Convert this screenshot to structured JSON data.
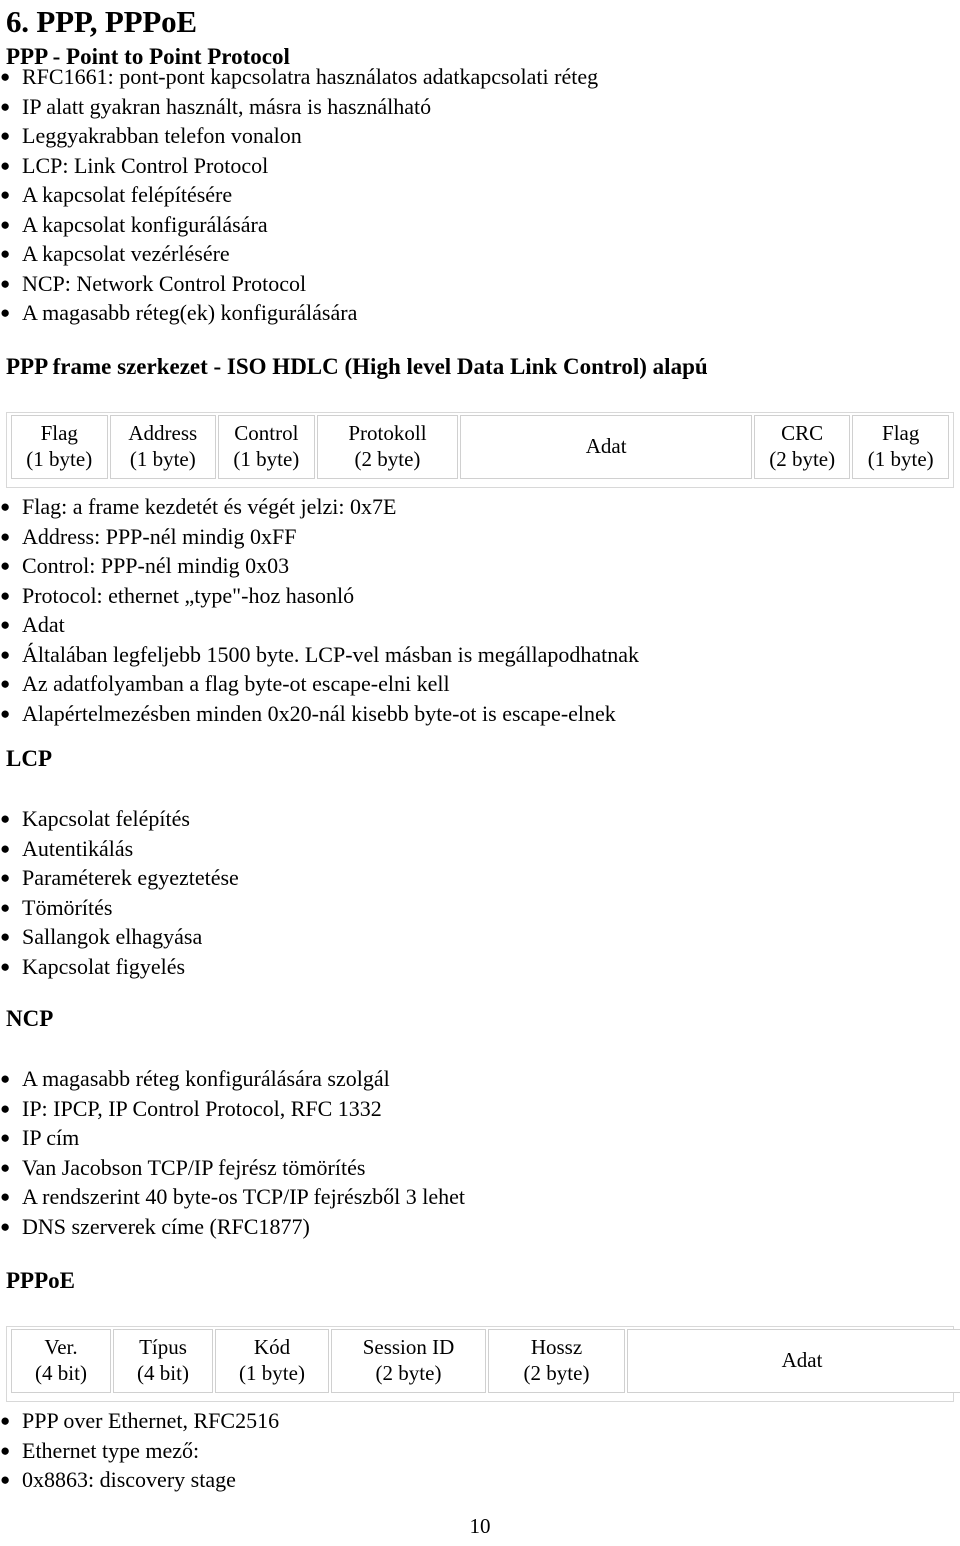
{
  "document": {
    "slide_number_label": "10",
    "title": "6. PPP, PPPoE",
    "subtitle": "PPP - Point to Point Protocol"
  },
  "intro_bullets": [
    {
      "level": 1,
      "text": "RFC1661: pont-pont kapcsolatra használatos adatkapcsolati réteg"
    },
    {
      "level": 1,
      "text": "IP alatt gyakran használt, másra is használható"
    },
    {
      "level": 1,
      "text": "Leggyakrabban telefon vonalon"
    },
    {
      "level": 1,
      "text": "LCP: Link Control Protocol"
    },
    {
      "level": 2,
      "text": "A kapcsolat felépítésére"
    },
    {
      "level": 2,
      "text": "A kapcsolat konfigurálására"
    },
    {
      "level": 2,
      "text": "A kapcsolat vezérlésére"
    },
    {
      "level": 1,
      "text": "NCP: Network Control Protocol"
    },
    {
      "level": 2,
      "text": "A magasabb réteg(ek) konfigurálására"
    }
  ],
  "ppp_frame": {
    "heading": "PPP frame szerkezet - ISO HDLC (High level Data Link Control) alapú",
    "fields": [
      {
        "name": "Flag",
        "size": "(1 byte)"
      },
      {
        "name": "Address",
        "size": "(1 byte)"
      },
      {
        "name": "Control",
        "size": "(1 byte)"
      },
      {
        "name": "Protokoll",
        "size": "(2 byte)"
      },
      {
        "name": "Adat",
        "size": ""
      },
      {
        "name": "CRC",
        "size": "(2 byte)"
      },
      {
        "name": "Flag",
        "size": "(1 byte)"
      }
    ],
    "bullets": [
      {
        "level": 1,
        "text": "Flag: a frame kezdetét és végét jelzi: 0x7E"
      },
      {
        "level": 1,
        "text": "Address: PPP-nél mindig 0xFF"
      },
      {
        "level": 1,
        "text": "Control: PPP-nél mindig 0x03"
      },
      {
        "level": 1,
        "text": "Protocol: ethernet „type\"-hoz hasonló"
      },
      {
        "level": 1,
        "text": "Adat"
      },
      {
        "level": 2,
        "text": "Általában legfeljebb 1500 byte. LCP-vel másban is megállapodhatnak"
      },
      {
        "level": 2,
        "text": "Az adatfolyamban a flag byte-ot escape-elni kell"
      },
      {
        "level": 2,
        "text": "Alapértelmezésben minden 0x20-nál kisebb byte-ot is escape-elnek"
      }
    ]
  },
  "lcp": {
    "heading": "LCP",
    "bullets": [
      {
        "level": 1,
        "text": "Kapcsolat felépítés"
      },
      {
        "level": 1,
        "text": "Autentikálás"
      },
      {
        "level": 1,
        "text": "Paraméterek egyeztetése"
      },
      {
        "level": 1,
        "text": "Tömörítés"
      },
      {
        "level": 1,
        "text": "Sallangok elhagyása"
      },
      {
        "level": 1,
        "text": "Kapcsolat figyelés"
      }
    ]
  },
  "ncp": {
    "heading": "NCP",
    "bullets": [
      {
        "level": 1,
        "text": "A magasabb réteg konfigurálására szolgál"
      },
      {
        "level": 1,
        "text": "IP: IPCP, IP Control Protocol, RFC 1332"
      },
      {
        "level": 2,
        "text": "IP cím"
      },
      {
        "level": 2,
        "text": "Van Jacobson TCP/IP fejrész tömörítés"
      },
      {
        "level": 3,
        "text": "A rendszerint 40 byte-os TCP/IP fejrészből 3 lehet"
      },
      {
        "level": 2,
        "text": "DNS szerverek címe (RFC1877)"
      }
    ]
  },
  "pppoe": {
    "heading": "PPPoE",
    "fields": [
      {
        "name": "Ver.",
        "size": "(4 bit)"
      },
      {
        "name": "Típus",
        "size": "(4 bit)"
      },
      {
        "name": "Kód",
        "size": "(1 byte)"
      },
      {
        "name": "Session ID",
        "size": "(2 byte)"
      },
      {
        "name": "Hossz",
        "size": "(2 byte)"
      },
      {
        "name": "Adat",
        "size": ""
      }
    ],
    "bullets": [
      {
        "level": 1,
        "text": "PPP over Ethernet, RFC2516"
      },
      {
        "level": 1,
        "text": "Ethernet type mező:"
      },
      {
        "level": 2,
        "text": "0x8863: discovery stage"
      }
    ]
  },
  "icons": {
    "bullet_glyph": "●"
  },
  "colors": {
    "text": "#000000",
    "table_border": "#d0d0d0",
    "table_outer_border": "#d8d8d8",
    "background": "#ffffff"
  }
}
